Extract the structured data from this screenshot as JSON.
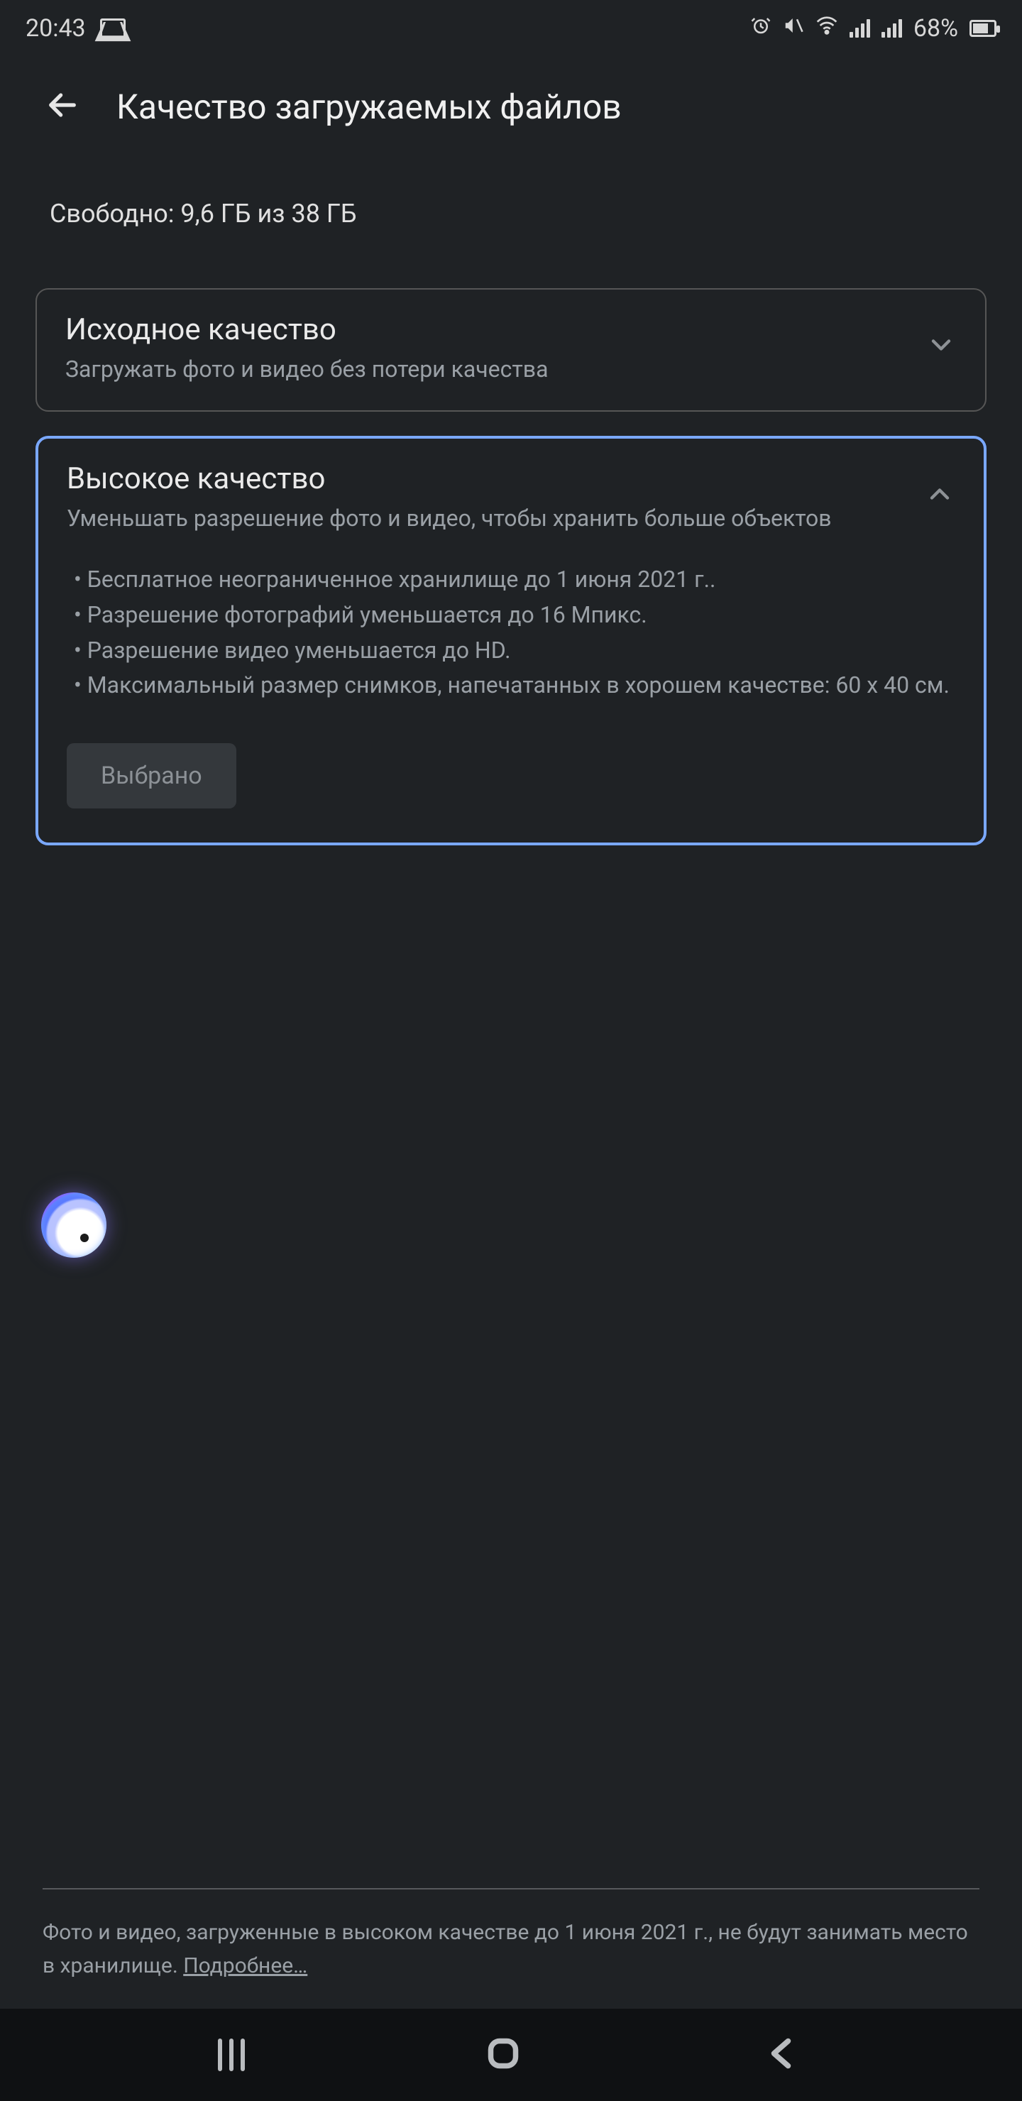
{
  "status": {
    "time": "20:43",
    "gmail_icon": "gmail",
    "battery_pct": "68%"
  },
  "header": {
    "title": "Качество загружаемых файлов"
  },
  "storage": {
    "line": "Свободно: 9,6 ГБ из 38 ГБ"
  },
  "cards": {
    "original": {
      "title": "Исходное качество",
      "subtitle": "Загружать фото и видео без потери качества"
    },
    "high": {
      "title": "Высокое качество",
      "subtitle": "Уменьшать разрешение фото и видео, чтобы хранить больше объектов",
      "bullets": [
        "• Бесплатное неограниченное хранилище до 1 июня 2021 г..",
        "• Разрешение фотографий уменьшается до 16 Мпикс.",
        "• Разрешение видео уменьшается до HD.",
        "• Максимальный размер снимков, напечатанных в хорошем качестве: 60 x 40 см."
      ],
      "selected_label": "Выбрано"
    }
  },
  "footer": {
    "text_prefix": "Фото и видео, загруженные в высоком качестве до 1 июня 2021 г., не будут занимать место в хранилище. ",
    "link": "Подробнее…"
  }
}
